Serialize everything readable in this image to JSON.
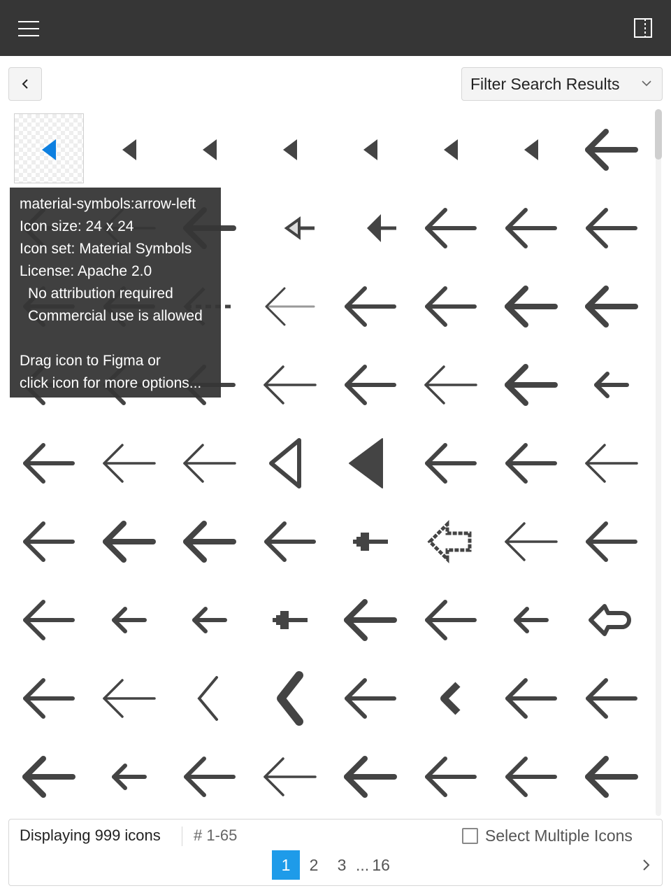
{
  "colors": {
    "topbar": "#363636",
    "accent": "#1e9be9",
    "icon": "#444444",
    "selected_icon": "#0e80e0"
  },
  "header": {
    "menu_icon": "hamburger-icon",
    "panel_icon": "sidebar-toggle-icon"
  },
  "toolbar": {
    "back_icon": "chevron-left-icon",
    "filter_label": "Filter Search Results",
    "filter_icon": "chevron-down-icon"
  },
  "tooltip": {
    "name": "material-symbols:arrow-left",
    "size": "Icon size: 24 x 24",
    "set": "Icon set: Material Symbols",
    "license": "License: Apache 2.0",
    "attribution": "No attribution required",
    "commercial": "Commercial use is allowed",
    "drag": "Drag icon to Figma or",
    "click": "click icon for more options..."
  },
  "footer": {
    "count": "Displaying 999 icons",
    "range": "# 1-65",
    "multi_label": "Select Multiple Icons",
    "pages": [
      "1",
      "2",
      "3"
    ],
    "dots": "...",
    "last_page": "16",
    "next_icon": "chevron-right-icon"
  }
}
